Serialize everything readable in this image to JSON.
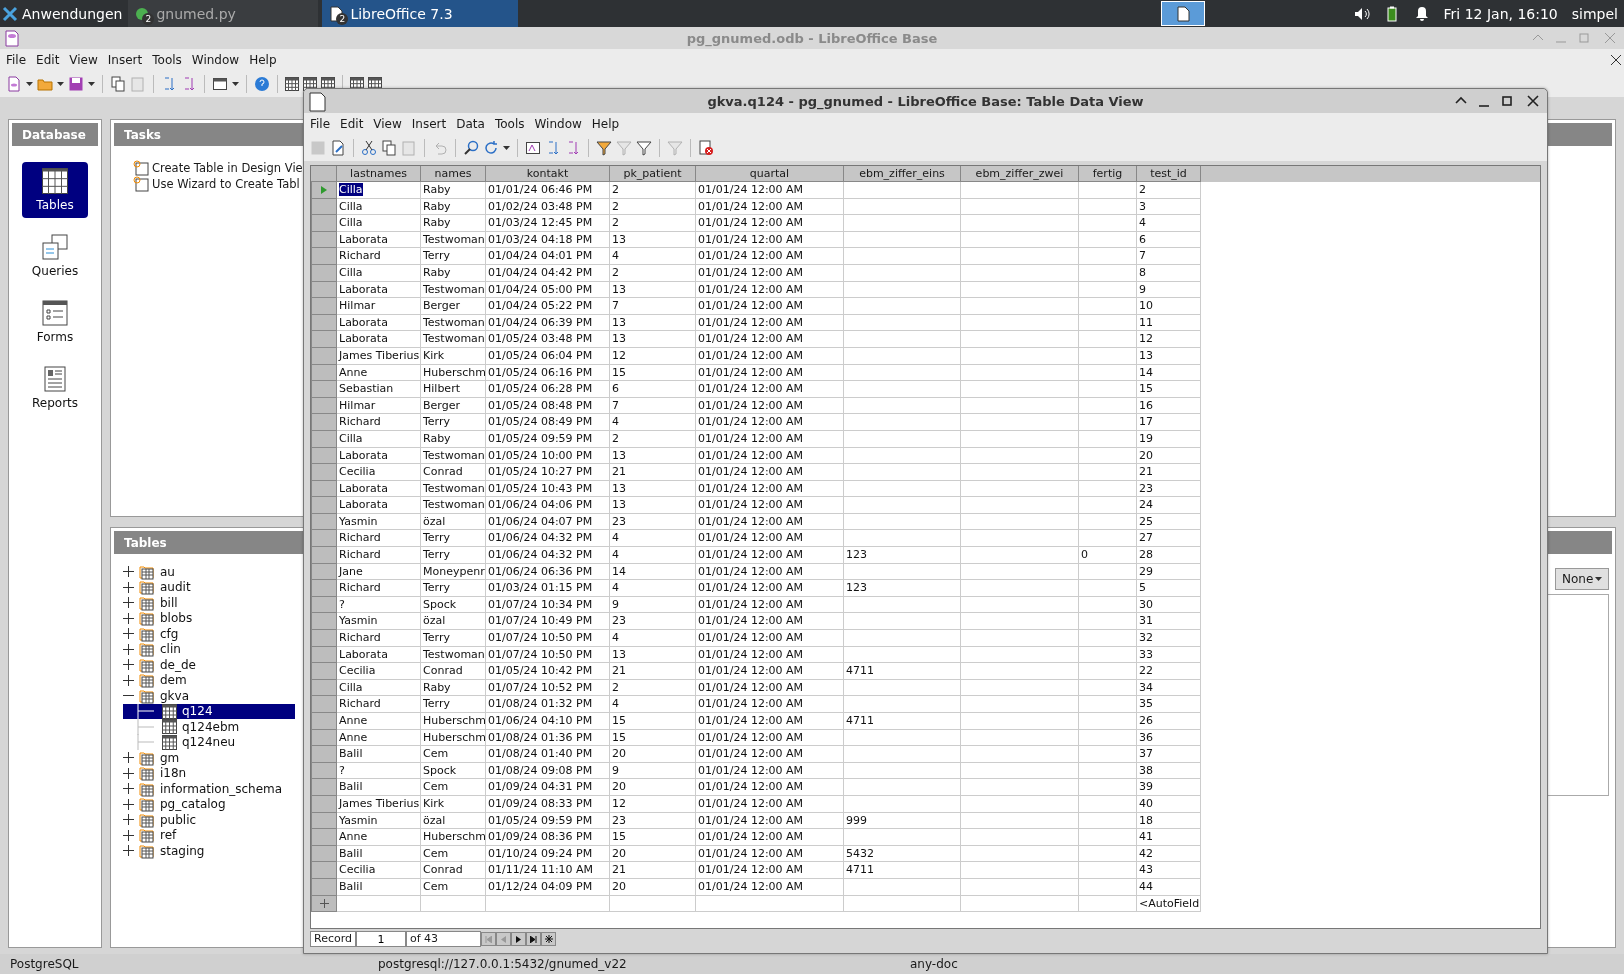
{
  "taskbar": {
    "launcher": "Anwendungen",
    "tasks": [
      {
        "label": "gnumed.py",
        "badge": "2",
        "selected": false
      },
      {
        "label": "LibreOffice 7.3",
        "badge": "2",
        "selected": true
      }
    ],
    "clock": "Fri 12 Jan, 16:10",
    "user": "simpel"
  },
  "main_window": {
    "title": "pg_gnumed.odb - LibreOffice Base",
    "menu": [
      "File",
      "Edit",
      "View",
      "Insert",
      "Tools",
      "Window",
      "Help"
    ],
    "database_panel": {
      "title": "Database",
      "items": [
        {
          "label": "Tables",
          "selected": true
        },
        {
          "label": "Queries",
          "selected": false
        },
        {
          "label": "Forms",
          "selected": false
        },
        {
          "label": "Reports",
          "selected": false
        }
      ]
    },
    "tasks_panel": {
      "title": "Tasks",
      "items": [
        "Create Table in Design Vie",
        "Use Wizard to Create Tabl"
      ]
    },
    "tables_panel": {
      "title": "Tables",
      "preview_mode": "None",
      "tree": [
        {
          "label": "au",
          "expanded": false,
          "selected": false
        },
        {
          "label": "audit",
          "expanded": false,
          "selected": false
        },
        {
          "label": "bill",
          "expanded": false,
          "selected": false
        },
        {
          "label": "blobs",
          "expanded": false,
          "selected": false
        },
        {
          "label": "cfg",
          "expanded": false,
          "selected": false
        },
        {
          "label": "clin",
          "expanded": false,
          "selected": false
        },
        {
          "label": "de_de",
          "expanded": false,
          "selected": false
        },
        {
          "label": "dem",
          "expanded": false,
          "selected": false
        },
        {
          "label": "gkva",
          "expanded": true,
          "selected": false,
          "children": [
            {
              "label": "q124",
              "selected": true
            },
            {
              "label": "q124ebm",
              "selected": false
            },
            {
              "label": "q124neu",
              "selected": false
            }
          ]
        },
        {
          "label": "gm",
          "expanded": false,
          "selected": false
        },
        {
          "label": "i18n",
          "expanded": false,
          "selected": false
        },
        {
          "label": "information_schema",
          "expanded": false,
          "selected": false
        },
        {
          "label": "pg_catalog",
          "expanded": false,
          "selected": false
        },
        {
          "label": "public",
          "expanded": false,
          "selected": false
        },
        {
          "label": "ref",
          "expanded": false,
          "selected": false
        },
        {
          "label": "staging",
          "expanded": false,
          "selected": false
        }
      ]
    },
    "status_bar": [
      "PostgreSQL",
      "postgresql://127.0.0.1:5432/gnumed_v22",
      "any-doc"
    ]
  },
  "data_window": {
    "title": "gkva.q124 - pg_gnumed - LibreOffice Base: Table Data View",
    "menu": [
      "File",
      "Edit",
      "View",
      "Insert",
      "Data",
      "Tools",
      "Window",
      "Help"
    ],
    "table": {
      "columns": [
        "lastnames",
        "names",
        "kontakt",
        "pk_patient",
        "quartal",
        "ebm_ziffer_eins",
        "ebm_ziffer_zwei",
        "fertig",
        "test_id"
      ],
      "rows": [
        {
          "selected": true,
          "lastnames": "Cilla",
          "names": "Raby",
          "kontakt": "01/01/24 06:46 PM",
          "pk_patient": "2",
          "quartal": "01/01/24 12:00 AM",
          "test_id": "2"
        },
        {
          "selected": false,
          "lastnames": "Cilla",
          "names": "Raby",
          "kontakt": "01/02/24 03:48 PM",
          "pk_patient": "2",
          "quartal": "01/01/24 12:00 AM",
          "test_id": "3"
        },
        {
          "selected": false,
          "lastnames": "Cilla",
          "names": "Raby",
          "kontakt": "01/03/24 12:45 PM",
          "pk_patient": "2",
          "quartal": "01/01/24 12:00 AM",
          "test_id": "4"
        },
        {
          "selected": false,
          "lastnames": "Laborata",
          "names": "Testwoman",
          "kontakt": "01/03/24 04:18 PM",
          "pk_patient": "13",
          "quartal": "01/01/24 12:00 AM",
          "test_id": "6"
        },
        {
          "selected": false,
          "lastnames": "Richard",
          "names": "Terry",
          "kontakt": "01/04/24 04:01 PM",
          "pk_patient": "4",
          "quartal": "01/01/24 12:00 AM",
          "test_id": "7"
        },
        {
          "selected": false,
          "lastnames": "Cilla",
          "names": "Raby",
          "kontakt": "01/04/24 04:42 PM",
          "pk_patient": "2",
          "quartal": "01/01/24 12:00 AM",
          "test_id": "8"
        },
        {
          "selected": false,
          "lastnames": "Laborata",
          "names": "Testwoman",
          "kontakt": "01/04/24 05:00 PM",
          "pk_patient": "13",
          "quartal": "01/01/24 12:00 AM",
          "test_id": "9"
        },
        {
          "selected": false,
          "lastnames": "Hilmar",
          "names": "Berger",
          "kontakt": "01/04/24 05:22 PM",
          "pk_patient": "7",
          "quartal": "01/01/24 12:00 AM",
          "test_id": "10"
        },
        {
          "selected": false,
          "lastnames": "Laborata",
          "names": "Testwoman",
          "kontakt": "01/04/24 06:39 PM",
          "pk_patient": "13",
          "quartal": "01/01/24 12:00 AM",
          "test_id": "11"
        },
        {
          "selected": false,
          "lastnames": "Laborata",
          "names": "Testwoman",
          "kontakt": "01/05/24 03:48 PM",
          "pk_patient": "13",
          "quartal": "01/01/24 12:00 AM",
          "test_id": "12"
        },
        {
          "selected": false,
          "lastnames": "James Tiberius",
          "names": "Kirk",
          "kontakt": "01/05/24 06:04 PM",
          "pk_patient": "12",
          "quartal": "01/01/24 12:00 AM",
          "test_id": "13"
        },
        {
          "selected": false,
          "lastnames": "Anne",
          "names": "Huberschm",
          "kontakt": "01/05/24 06:16 PM",
          "pk_patient": "15",
          "quartal": "01/01/24 12:00 AM",
          "test_id": "14"
        },
        {
          "selected": false,
          "lastnames": "Sebastian",
          "names": "Hilbert",
          "kontakt": "01/05/24 06:28 PM",
          "pk_patient": "6",
          "quartal": "01/01/24 12:00 AM",
          "test_id": "15"
        },
        {
          "selected": false,
          "lastnames": "Hilmar",
          "names": "Berger",
          "kontakt": "01/05/24 08:48 PM",
          "pk_patient": "7",
          "quartal": "01/01/24 12:00 AM",
          "test_id": "16"
        },
        {
          "selected": false,
          "lastnames": "Richard",
          "names": "Terry",
          "kontakt": "01/05/24 08:49 PM",
          "pk_patient": "4",
          "quartal": "01/01/24 12:00 AM",
          "test_id": "17"
        },
        {
          "selected": false,
          "lastnames": "Cilla",
          "names": "Raby",
          "kontakt": "01/05/24 09:59 PM",
          "pk_patient": "2",
          "quartal": "01/01/24 12:00 AM",
          "test_id": "19"
        },
        {
          "selected": false,
          "lastnames": "Laborata",
          "names": "Testwoman",
          "kontakt": "01/05/24 10:00 PM",
          "pk_patient": "13",
          "quartal": "01/01/24 12:00 AM",
          "test_id": "20"
        },
        {
          "selected": false,
          "lastnames": "Cecilia",
          "names": "Conrad",
          "kontakt": "01/05/24 10:27 PM",
          "pk_patient": "21",
          "quartal": "01/01/24 12:00 AM",
          "test_id": "21"
        },
        {
          "selected": false,
          "lastnames": "Laborata",
          "names": "Testwoman",
          "kontakt": "01/05/24 10:43 PM",
          "pk_patient": "13",
          "quartal": "01/01/24 12:00 AM",
          "test_id": "23"
        },
        {
          "selected": false,
          "lastnames": "Laborata",
          "names": "Testwoman",
          "kontakt": "01/06/24 04:06 PM",
          "pk_patient": "13",
          "quartal": "01/01/24 12:00 AM",
          "test_id": "24"
        },
        {
          "selected": false,
          "lastnames": "Yasmin",
          "names": "özal",
          "kontakt": "01/06/24 04:07 PM",
          "pk_patient": "23",
          "quartal": "01/01/24 12:00 AM",
          "test_id": "25"
        },
        {
          "selected": false,
          "lastnames": "Richard",
          "names": "Terry",
          "kontakt": "01/06/24 04:32 PM",
          "pk_patient": "4",
          "quartal": "01/01/24 12:00 AM",
          "test_id": "27"
        },
        {
          "selected": false,
          "lastnames": "Richard",
          "names": "Terry",
          "kontakt": "01/06/24 04:32 PM",
          "pk_patient": "4",
          "quartal": "01/01/24 12:00 AM",
          "ebm_ziffer_eins": "123",
          "fertig": "0",
          "test_id": "28"
        },
        {
          "selected": false,
          "lastnames": "Jane",
          "names": "Moneypenr",
          "kontakt": "01/06/24 06:36 PM",
          "pk_patient": "14",
          "quartal": "01/01/24 12:00 AM",
          "test_id": "29"
        },
        {
          "selected": false,
          "lastnames": "Richard",
          "names": "Terry",
          "kontakt": "01/03/24 01:15 PM",
          "pk_patient": "4",
          "quartal": "01/01/24 12:00 AM",
          "ebm_ziffer_eins": "123",
          "test_id": "5"
        },
        {
          "selected": false,
          "lastnames": "?",
          "names": "Spock",
          "kontakt": "01/07/24 10:34 PM",
          "pk_patient": "9",
          "quartal": "01/01/24 12:00 AM",
          "test_id": "30"
        },
        {
          "selected": false,
          "lastnames": "Yasmin",
          "names": "özal",
          "kontakt": "01/07/24 10:49 PM",
          "pk_patient": "23",
          "quartal": "01/01/24 12:00 AM",
          "test_id": "31"
        },
        {
          "selected": false,
          "lastnames": "Richard",
          "names": "Terry",
          "kontakt": "01/07/24 10:50 PM",
          "pk_patient": "4",
          "quartal": "01/01/24 12:00 AM",
          "test_id": "32"
        },
        {
          "selected": false,
          "lastnames": "Laborata",
          "names": "Testwoman",
          "kontakt": "01/07/24 10:50 PM",
          "pk_patient": "13",
          "quartal": "01/01/24 12:00 AM",
          "test_id": "33"
        },
        {
          "selected": false,
          "lastnames": "Cecilia",
          "names": "Conrad",
          "kontakt": "01/05/24 10:42 PM",
          "pk_patient": "21",
          "quartal": "01/01/24 12:00 AM",
          "ebm_ziffer_eins": "4711",
          "test_id": "22"
        },
        {
          "selected": false,
          "lastnames": "Cilla",
          "names": "Raby",
          "kontakt": "01/07/24 10:52 PM",
          "pk_patient": "2",
          "quartal": "01/01/24 12:00 AM",
          "test_id": "34"
        },
        {
          "selected": false,
          "lastnames": "Richard",
          "names": "Terry",
          "kontakt": "01/08/24 01:32 PM",
          "pk_patient": "4",
          "quartal": "01/01/24 12:00 AM",
          "test_id": "35"
        },
        {
          "selected": false,
          "lastnames": "Anne",
          "names": "Huberschm",
          "kontakt": "01/06/24 04:10 PM",
          "pk_patient": "15",
          "quartal": "01/01/24 12:00 AM",
          "ebm_ziffer_eins": "4711",
          "test_id": "26"
        },
        {
          "selected": false,
          "lastnames": "Anne",
          "names": "Huberschm",
          "kontakt": "01/08/24 01:36 PM",
          "pk_patient": "15",
          "quartal": "01/01/24 12:00 AM",
          "test_id": "36"
        },
        {
          "selected": false,
          "lastnames": "Balil",
          "names": "Cem",
          "kontakt": "01/08/24 01:40 PM",
          "pk_patient": "20",
          "quartal": "01/01/24 12:00 AM",
          "test_id": "37"
        },
        {
          "selected": false,
          "lastnames": "?",
          "names": "Spock",
          "kontakt": "01/08/24 09:08 PM",
          "pk_patient": "9",
          "quartal": "01/01/24 12:00 AM",
          "test_id": "38"
        },
        {
          "selected": false,
          "lastnames": "Balil",
          "names": "Cem",
          "kontakt": "01/09/24 04:31 PM",
          "pk_patient": "20",
          "quartal": "01/01/24 12:00 AM",
          "test_id": "39"
        },
        {
          "selected": false,
          "lastnames": "James Tiberius",
          "names": "Kirk",
          "kontakt": "01/09/24 08:33 PM",
          "pk_patient": "12",
          "quartal": "01/01/24 12:00 AM",
          "test_id": "40"
        },
        {
          "selected": false,
          "lastnames": "Yasmin",
          "names": "özal",
          "kontakt": "01/05/24 09:59 PM",
          "pk_patient": "23",
          "quartal": "01/01/24 12:00 AM",
          "ebm_ziffer_eins": "999",
          "test_id": "18"
        },
        {
          "selected": false,
          "lastnames": "Anne",
          "names": "Huberschm",
          "kontakt": "01/09/24 08:36 PM",
          "pk_patient": "15",
          "quartal": "01/01/24 12:00 AM",
          "test_id": "41"
        },
        {
          "selected": false,
          "lastnames": "Balil",
          "names": "Cem",
          "kontakt": "01/10/24 09:24 PM",
          "pk_patient": "20",
          "quartal": "01/01/24 12:00 AM",
          "ebm_ziffer_eins": "5432",
          "test_id": "42"
        },
        {
          "selected": false,
          "lastnames": "Cecilia",
          "names": "Conrad",
          "kontakt": "01/11/24 11:10 AM",
          "pk_patient": "21",
          "quartal": "01/01/24 12:00 AM",
          "ebm_ziffer_eins": "4711",
          "test_id": "43"
        },
        {
          "selected": false,
          "lastnames": "Balil",
          "names": "Cem",
          "kontakt": "01/12/24 04:09 PM",
          "pk_patient": "20",
          "quartal": "01/01/24 12:00 AM",
          "test_id": "44"
        }
      ],
      "new_row": {
        "test_id": "<AutoField"
      }
    },
    "record_bar": {
      "label": "Record",
      "value": "1",
      "total": "of 43"
    }
  }
}
